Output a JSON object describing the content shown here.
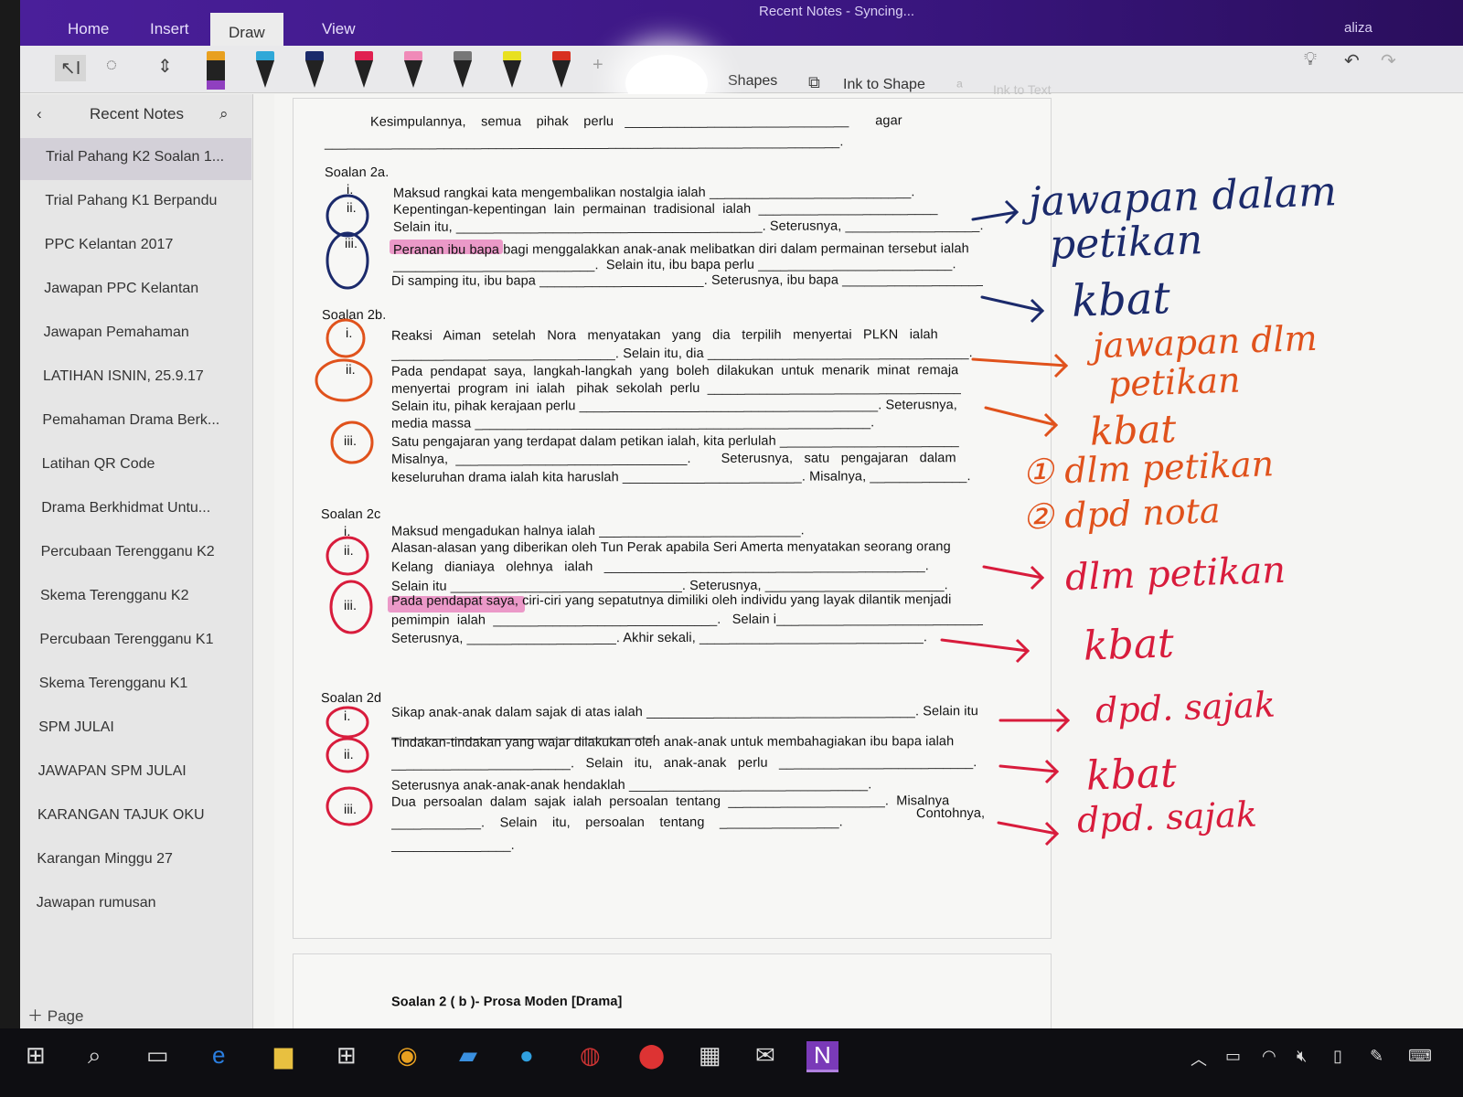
{
  "window": {
    "title": "Recent Notes - Syncing...",
    "user": "aliza"
  },
  "tabs": [
    {
      "label": "Home"
    },
    {
      "label": "Insert"
    },
    {
      "label": "Draw"
    },
    {
      "label": "View"
    }
  ],
  "toolbar": {
    "shapes": "Shapes",
    "ink_to_shape": "Ink to Shape",
    "ink_to_text": "Ink to Text",
    "pens": [
      "#e8a020",
      "#30a8d8",
      "#1a2a6a",
      "#e02050",
      "#f08ab8",
      "#777777",
      "#e8e020",
      "#d83020"
    ]
  },
  "sidebar": {
    "title": "Recent Notes",
    "add_page": "Page",
    "items": [
      "Trial Pahang K2 Soalan 1...",
      "Trial Pahang K1 Berpandu",
      "PPC Kelantan 2017",
      "Jawapan PPC Kelantan",
      "Jawapan Pemahaman",
      "LATIHAN ISNIN, 25.9.17",
      "Pemahaman Drama Berk...",
      "Latihan QR Code",
      "Drama Berkhidmat Untu...",
      "Percubaan Terengganu K2",
      "Skema Terengganu K2",
      "Percubaan Terengganu K1",
      "Skema Terengganu K1",
      "SPM JULAI",
      "JAWAPAN SPM JULAI",
      "KARANGAN TAJUK OKU",
      "Karangan Minggu 27",
      "Jawapan rumusan"
    ]
  },
  "document": {
    "lines": [
      "Kesimpulannya,    semua    pihak    perlu   ______________________________       agar",
      "_____________________________________________________________________.",
      "Soalan 2a.",
      "i.",
      "Maksud rangkai kata mengembalikan nostalgia ialah ___________________________.",
      "ii.",
      "Kepentingan-kepentingan  lain  permainan  tradisional  ialah  ________________________",
      "Selain itu, _________________________________________. Seterusnya, __________________.",
      "iii.",
      "Peranan ibu bapa bagi menggalakkan anak-anak melibatkan diri dalam permainan tersebut ialah",
      "___________________________.  Selain itu, ibu bapa perlu __________________________.",
      "Di samping itu, ibu bapa ______________________. Seterusnya, ibu bapa ___________________.",
      "Soalan 2b.",
      "i.",
      "Reaksi   Aiman   setelah   Nora   menyatakan   yang   dia   terpilih   menyertai   PLKN   ialah",
      "______________________________. Selain itu, dia ___________________________________.",
      "ii.",
      "Pada  pendapat  saya,  langkah-langkah  yang  boleh  dilakukan  untuk  menarik  minat  remaja",
      "menyertai  program  ini  ialah   pihak  sekolah  perlu  __________________________________",
      "Selain itu, pihak kerajaan perlu ________________________________________. Seterusnya,",
      "media massa _____________________________________________________.",
      "iii.",
      "Satu pengajaran yang terdapat dalam petikan ialah, kita perlulah ________________________",
      "Misalnya,  _______________________________.        Seterusnya,   satu   pengajaran   dalam",
      "keseluruhan drama ialah kita haruslah ________________________. Misalnya, _____________.",
      "Soalan 2c",
      "i.",
      "Maksud mengadukan halnya ialah ___________________________.",
      "ii.",
      "Alasan-alasan yang diberikan oleh Tun Perak apabila Seri Amerta menyatakan seorang orang",
      "Kelang   dianiaya   olehnya   ialah   ___________________________________________.",
      "Selain itu _______________________________. Seterusnya, ________________________.",
      "iii.",
      "Pada pendapat saya, ciri-ciri yang sepatutnya dimiliki oleh individu yang layak dilantik menjadi",
      "pemimpin  ialah  ______________________________.   Selain i____________________________.",
      "Seterusnya, ____________________. Akhir sekali, ______________________________.",
      "Soalan 2d",
      "i.",
      "Sikap anak-anak dalam sajak di atas ialah ____________________________________. Selain itu",
      "___________________________________.",
      "ii.",
      "Tindakan-tindakan yang wajar dilakukan oleh anak-anak untuk membahagiakan ibu bapa ialah",
      "________________________.   Selain   itu,   anak-anak   perlu   __________________________.",
      "Seterusnya anak-anak-anak hendaklah ________________________________.",
      "iii.",
      "Dua  persoalan  dalam  sajak  ialah  persoalan  tentang  _____________________.  Misalnya",
      "Contohnya,",
      "____________.    Selain    itu,    persoalan    tentang    ________________.",
      "________________.",
      "Soalan 2 ( b )- Prosa Moden [Drama]"
    ]
  },
  "annotations": {
    "blue": [
      "jawapan dalam",
      "petikan",
      "kbat"
    ],
    "orange": [
      "jawapan dlm",
      "petikan",
      "kbat",
      "① dlm petikan",
      "② dpd nota"
    ],
    "red": [
      "dlm petikan",
      "kbat",
      "dpd. sajak",
      "kbat",
      "dpd. sajak"
    ],
    "colors": {
      "blue": "#1b2a6b",
      "orange": "#e0521c",
      "red": "#d81c3c",
      "highlight": "#e77ab8"
    }
  }
}
